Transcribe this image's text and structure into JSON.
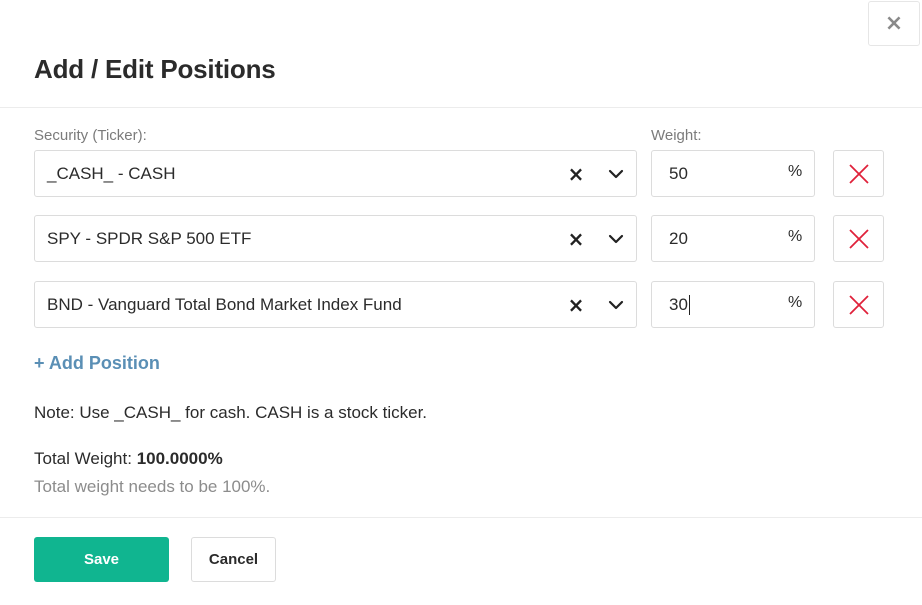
{
  "dialog": {
    "title": "Add / Edit Positions",
    "close_icon": "close-icon",
    "close_glyph": "×"
  },
  "form": {
    "security_label": "Security (Ticker):",
    "weight_label": "Weight:",
    "percent_symbol": "%",
    "clear_glyph": "×",
    "positions": [
      {
        "security": "_CASH_ - CASH",
        "weight": "50"
      },
      {
        "security": "SPY - SPDR S&P 500 ETF",
        "weight": "20"
      },
      {
        "security": "BND - Vanguard Total Bond Market Index Fund",
        "weight": "30"
      }
    ],
    "add_position_label": "+ Add Position"
  },
  "info": {
    "note": "Note: Use _CASH_ for cash. CASH is a stock ticker.",
    "total_weight_label": "Total Weight: ",
    "total_weight_value": "100.0000%",
    "hint": "Total weight needs to be 100%."
  },
  "footer": {
    "save_label": "Save",
    "cancel_label": "Cancel"
  },
  "colors": {
    "accent_save": "#10b590",
    "link": "#5a8fb5",
    "remove": "#e0213a"
  },
  "icons": {
    "clear": "clear-icon",
    "dropdown": "chevron-down-icon",
    "remove": "remove-x-icon"
  }
}
